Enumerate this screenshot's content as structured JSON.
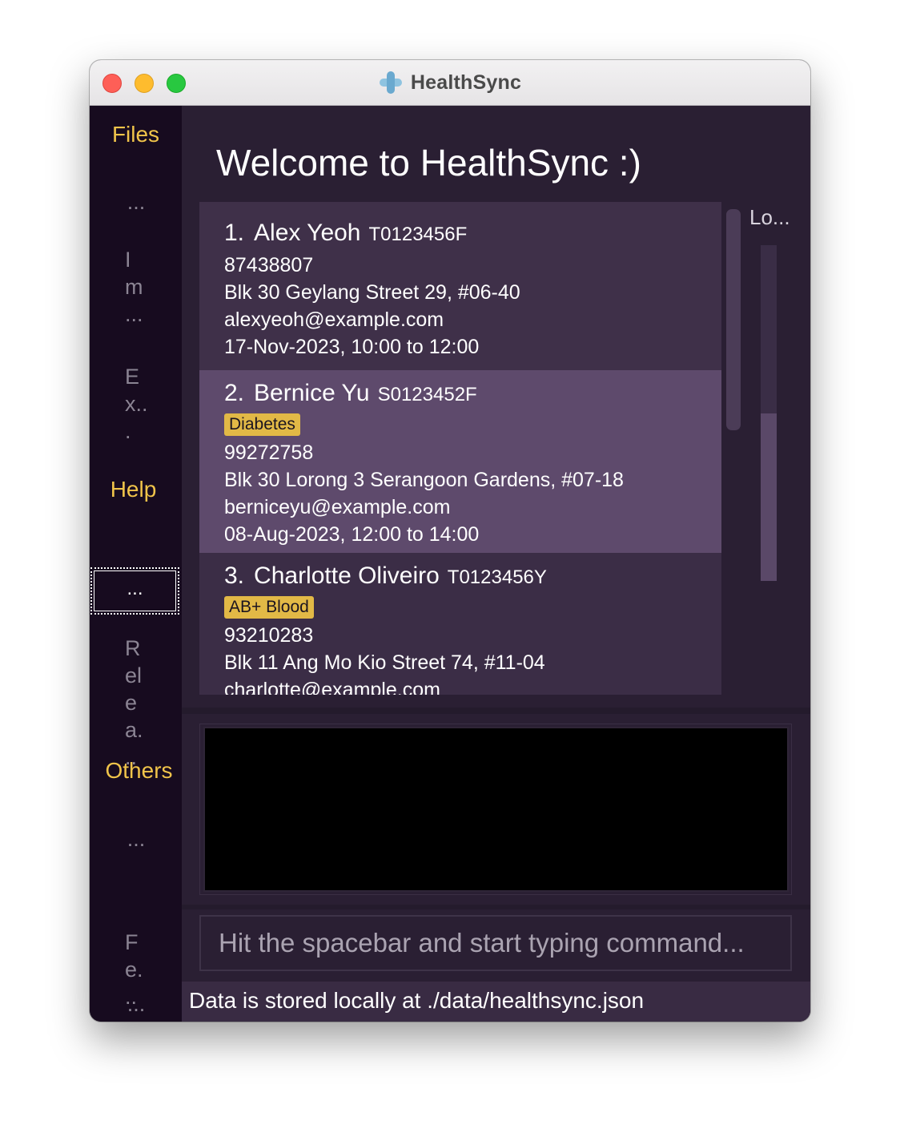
{
  "window": {
    "title": "HealthSync"
  },
  "sidebar": {
    "files_header": "Files",
    "files_items": [
      {
        "text": "..."
      },
      {
        "text": "I\nm\n..."
      },
      {
        "text": "E\nx..\n."
      }
    ],
    "help_header": "Help",
    "help_items": [
      {
        "text": "..."
      },
      {
        "text": "R\nel\ne\na.\n.."
      }
    ],
    "others_header": "Others",
    "others_items": [
      {
        "text": "..."
      },
      {
        "text": "F\ne.\n.."
      },
      {
        "text": "..."
      }
    ]
  },
  "main": {
    "welcome": "Welcome to HealthSync :)",
    "persons": [
      {
        "index": "1.",
        "name": "Alex Yeoh",
        "nric": "T0123456F",
        "tags": [],
        "phone": "87438807",
        "address": "Blk 30 Geylang Street 29, #06-40",
        "email": "alexyeoh@example.com",
        "appointment": "17-Nov-2023, 10:00 to 12:00"
      },
      {
        "index": "2.",
        "name": "Bernice Yu",
        "nric": "S0123452F",
        "tags": [
          "Diabetes"
        ],
        "phone": "99272758",
        "address": "Blk 30 Lorong 3 Serangoon Gardens, #07-18",
        "email": "berniceyu@example.com",
        "appointment": "08-Aug-2023, 12:00 to 14:00"
      },
      {
        "index": "3.",
        "name": "Charlotte Oliveiro",
        "nric": "T0123456Y",
        "tags": [
          "AB+ Blood"
        ],
        "phone": "93210283",
        "address": "Blk 11 Ang Mo Kio Street 74, #11-04",
        "email": "charlotte@example.com"
      }
    ],
    "right_panel_title": "Lo...",
    "command_placeholder": "Hit the spacebar and start typing command...",
    "command_value": "",
    "result_text": "",
    "status": "Data is stored locally at ./data/healthsync.json"
  },
  "colors": {
    "accent": "#f0c44a",
    "tag": "#e2b946",
    "sidebar_bg": "#170b1f",
    "main_bg": "#2a1f33",
    "selected_card": "#5e4a6c"
  }
}
